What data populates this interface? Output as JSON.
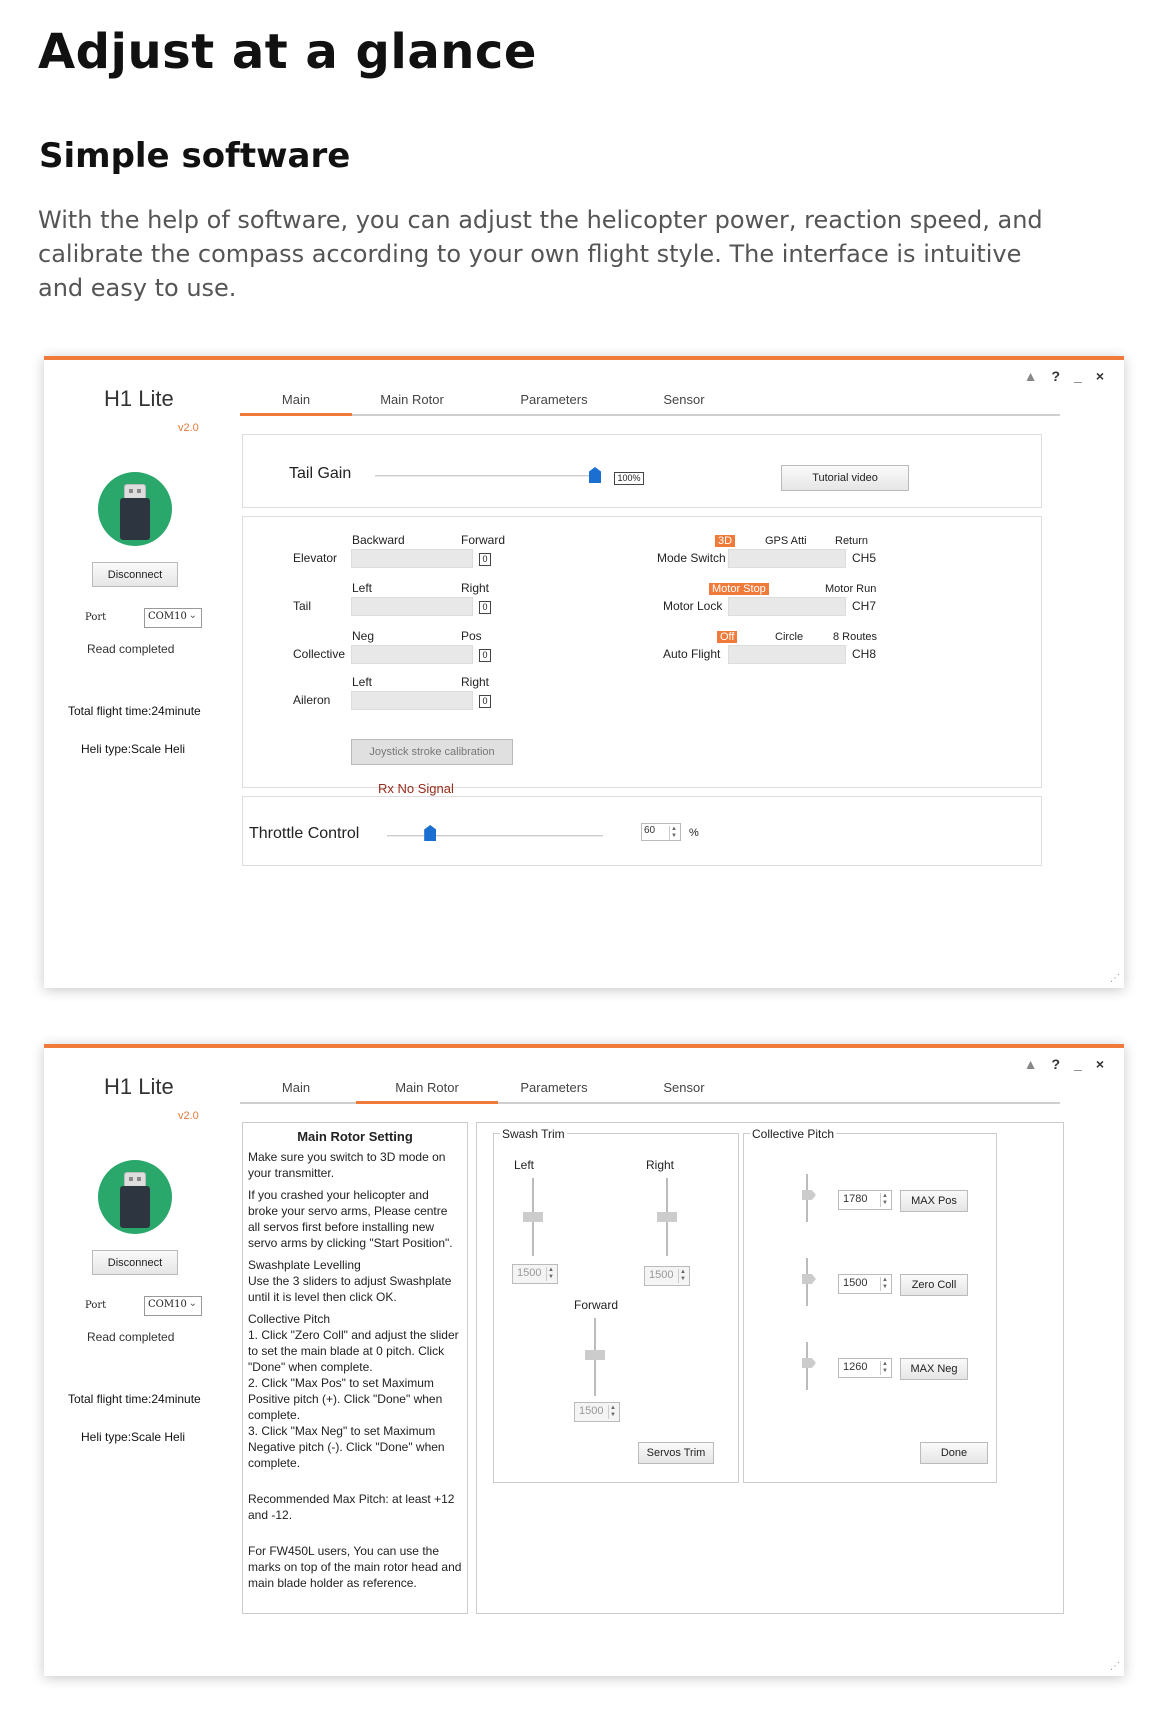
{
  "page": {
    "heading": "Adjust at a glance",
    "subheading": "Simple software",
    "description": "With the help of  software, you can adjust the helicopter power, reaction speed, and calibrate the compass according to your own flight style. The interface is intuitive and easy to use."
  },
  "accent_color": "#f07a3a",
  "side": {
    "app_title": "H1 Lite",
    "version": "v2.0",
    "avatar_icon": "usb-icon",
    "disconnect_label": "Disconnect",
    "port_label": "Port",
    "port_value": "COM10",
    "read_status": "Read completed",
    "flight_time": "Total flight time:24minute",
    "heli_type": "Heli type:Scale Heli"
  },
  "window_controls": {
    "skin": "shirt-icon",
    "help": "?",
    "minimize": "_",
    "close": "×"
  },
  "tabs": [
    "Main",
    "Main Rotor",
    "Parameters",
    "Sensor"
  ],
  "main": {
    "tail_gain": {
      "label": "Tail Gain",
      "value": "100%",
      "percent": 100
    },
    "tutorial_label": "Tutorial video",
    "channels": [
      {
        "label": "Elevator",
        "left": "Backward",
        "right": "Forward",
        "value": "0"
      },
      {
        "label": "Tail",
        "left": "Left",
        "right": "Right",
        "value": "0"
      },
      {
        "label": "Collective",
        "left": "Neg",
        "right": "Pos",
        "value": "0"
      },
      {
        "label": "Aileron",
        "left": "Left",
        "right": "Right",
        "value": "0"
      }
    ],
    "calibration_label": "Joystick stroke calibration",
    "rx_status": "Rx No Signal",
    "switches": [
      {
        "label": "Mode Switch",
        "ch": "CH5",
        "opts": [
          "3D",
          "GPS Atti",
          "Return"
        ],
        "active": 0
      },
      {
        "label": "Motor Lock",
        "ch": "CH7",
        "opts": [
          "Motor Stop",
          "Motor Run"
        ],
        "active": 0
      },
      {
        "label": "Auto Flight",
        "ch": "CH8",
        "opts": [
          "Off",
          "Circle",
          "8 Routes"
        ],
        "active": 0
      }
    ],
    "throttle": {
      "label": "Throttle Control",
      "value": "60",
      "unit": "%",
      "fraction": 0.2
    }
  },
  "rotor": {
    "heading": "Main Rotor Setting",
    "instructions": [
      "Make sure you switch to 3D mode on your transmitter.",
      "If you crashed your helicopter and broke your servo arms, Please centre all servos first before installing new servo arms by clicking \"Start Position\".",
      "Swashplate Levelling\nUse the 3 sliders to adjust Swashplate until it is level then click OK.",
      "Collective Pitch\n1. Click \"Zero Coll\" and adjust the slider to set the main blade at 0 pitch. Click \"Done\" when complete.\n2. Click \"Max Pos\" to set Maximum Positive pitch (+). Click \"Done\" when complete.\n3. Click \"Max Neg\" to set Maximum Negative pitch (-). Click \"Done\" when complete.",
      "",
      "Recommended Max Pitch: at least +12 and -12.",
      "",
      "For FW450L users, You can use the marks on top of the main rotor head and main blade holder as reference."
    ],
    "swash": {
      "title": "Swash Trim",
      "left": {
        "label": "Left",
        "value": "1500"
      },
      "right": {
        "label": "Right",
        "value": "1500"
      },
      "forward": {
        "label": "Forward",
        "value": "1500"
      },
      "servos_trim_label": "Servos Trim"
    },
    "pitch": {
      "title": "Collective Pitch",
      "rows": [
        {
          "value": "1780",
          "button": "MAX Pos"
        },
        {
          "value": "1500",
          "button": "Zero Coll"
        },
        {
          "value": "1260",
          "button": "MAX Neg"
        }
      ],
      "done_label": "Done"
    }
  }
}
